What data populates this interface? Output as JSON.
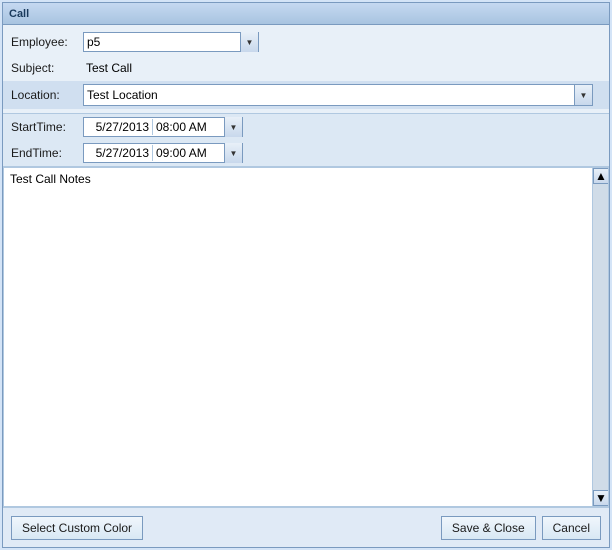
{
  "window": {
    "title": "Call"
  },
  "form": {
    "employee_label": "Employee:",
    "employee_value": "p5",
    "subject_label": "Subject:",
    "subject_value": "Test Call",
    "location_label": "Location:",
    "location_value": "Test Location",
    "start_time_label": "StartTime:",
    "start_date_value": "5/27/2013",
    "start_time_value": "08:00 AM",
    "end_time_label": "EndTime:",
    "end_date_value": "5/27/2013",
    "end_time_value": "09:00 AM",
    "notes_value": "Test Call Notes"
  },
  "footer": {
    "custom_color_label": "Select Custom Color",
    "save_close_label": "Save & Close",
    "cancel_label": "Cancel"
  },
  "icons": {
    "dropdown_arrow": "▼",
    "scroll_up": "▲",
    "scroll_down": "▼"
  }
}
